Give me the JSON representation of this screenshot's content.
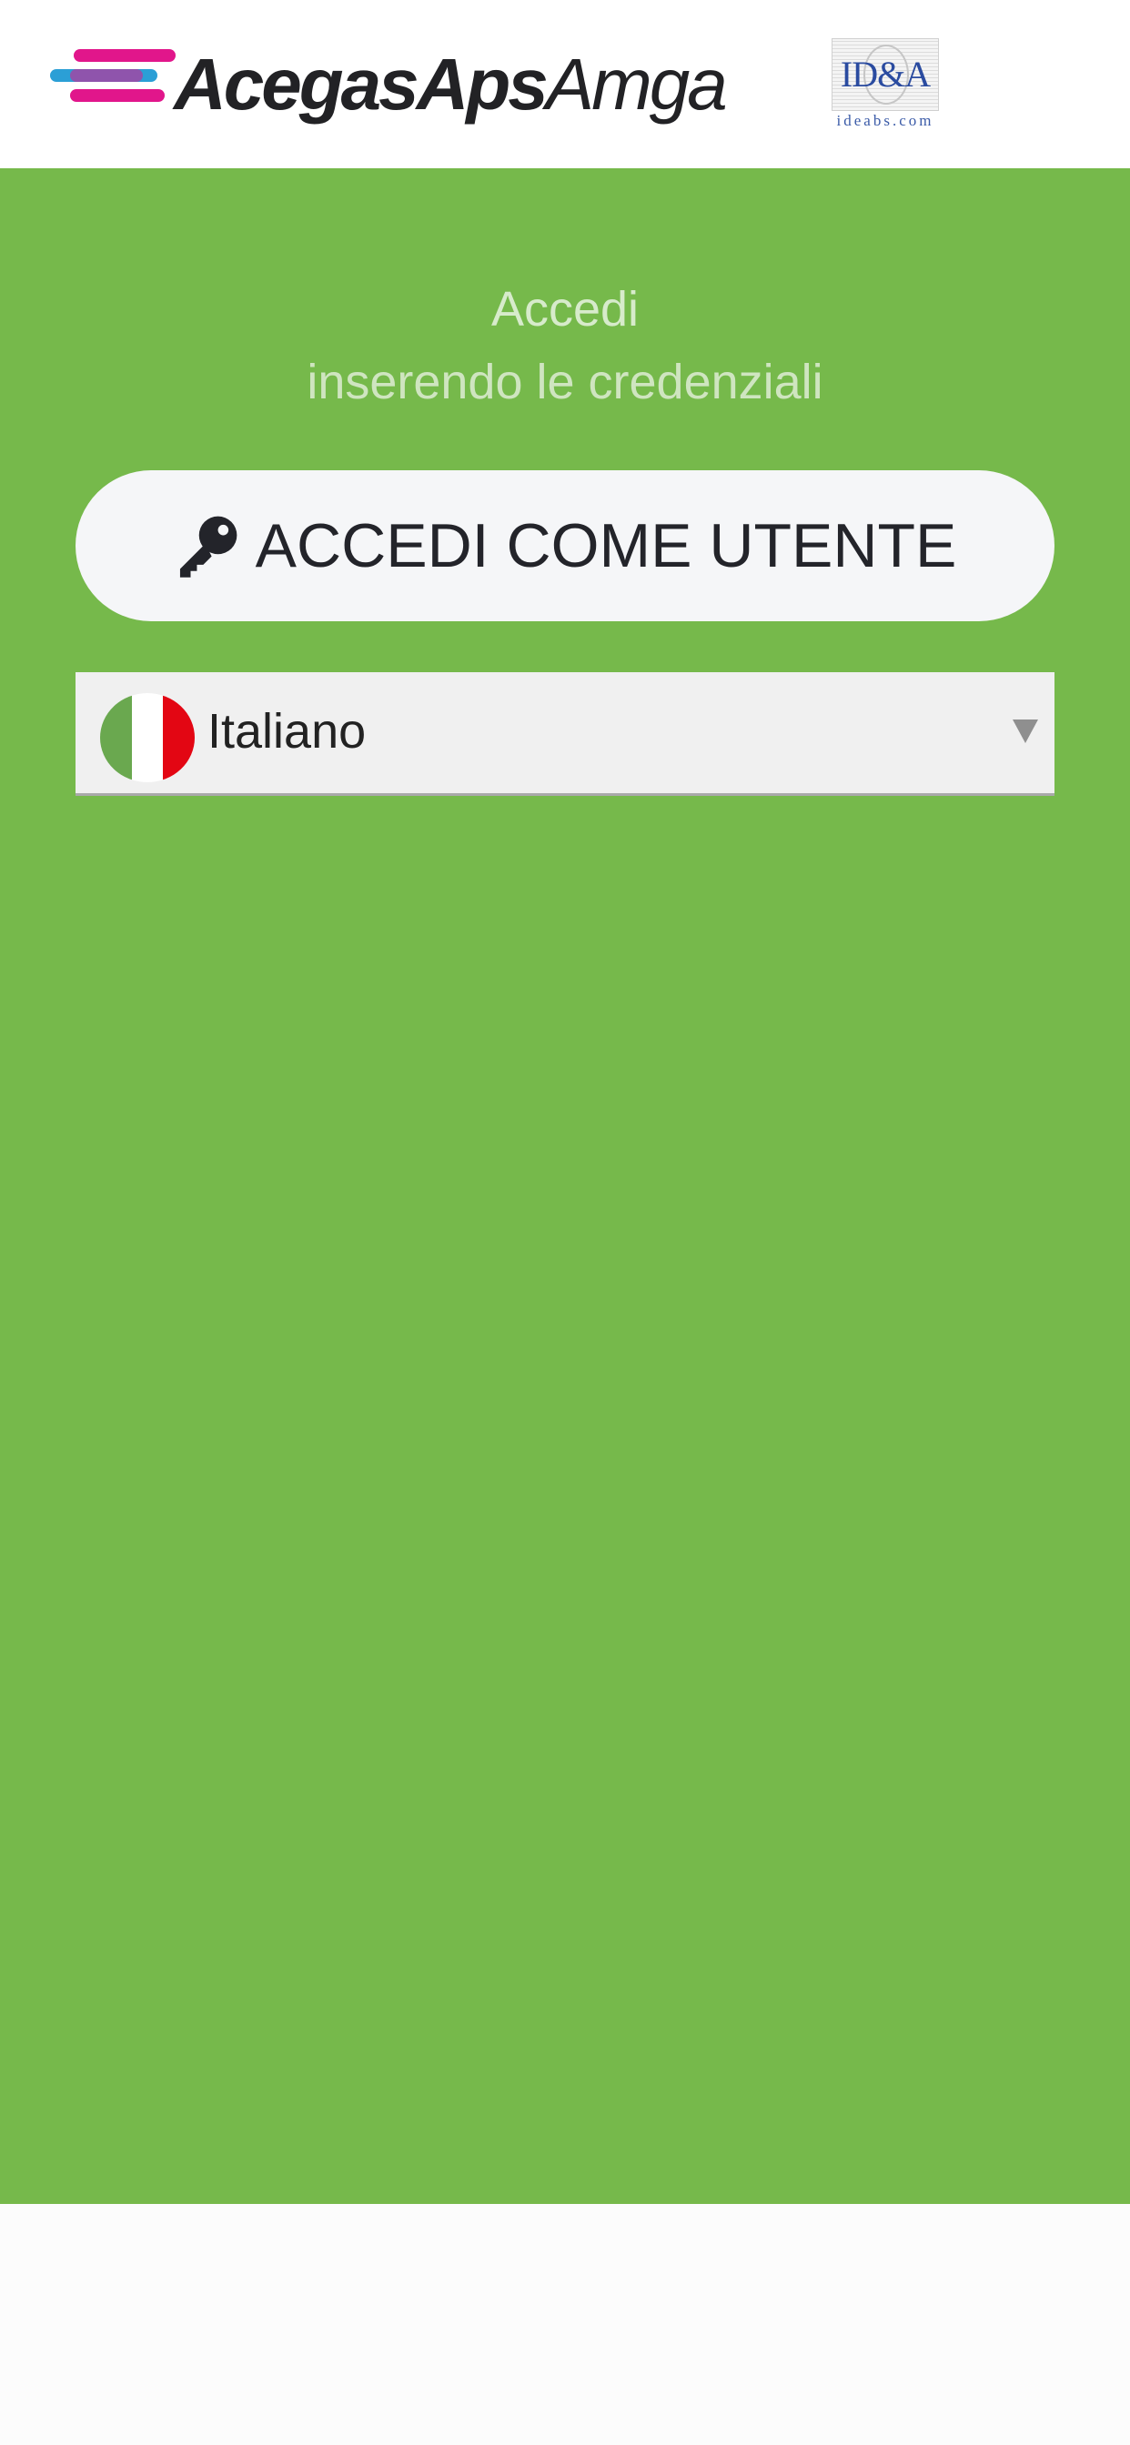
{
  "header": {
    "brand": {
      "name_bold": "AcegasAps",
      "name_light": "Amga",
      "stripe_colors": [
        "#e1168b",
        "#2b9fd6",
        "#e1168b"
      ]
    },
    "partner": {
      "mark_text": "ID&A",
      "domain_text": "ideabs.com"
    }
  },
  "main": {
    "background": "#76b94b",
    "title": "Accedi",
    "subtitle": "inserendo le credenziali",
    "login_button": {
      "icon": "key-icon",
      "label": "ACCEDI COME UTENTE"
    },
    "language_select": {
      "flag_icon": "italy-flag-icon",
      "flag_colors": [
        "#6aa84f",
        "#ffffff",
        "#e30613"
      ],
      "value": "Italiano",
      "arrow_icon": "triangle-down-icon"
    }
  }
}
